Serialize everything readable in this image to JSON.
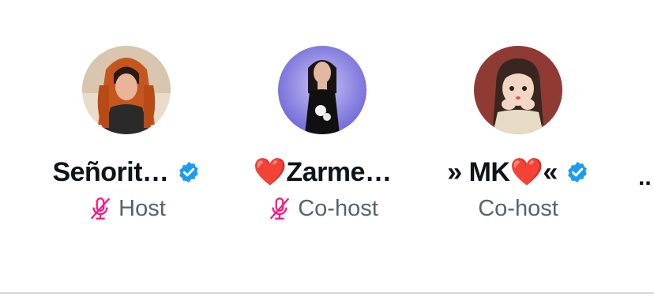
{
  "speakers": [
    {
      "name": "Señorit…",
      "verified": true,
      "role": "Host",
      "mic_muted": true,
      "avatar": "woman-red-hair-avatar"
    },
    {
      "name_heart": "❤️",
      "name": "Zarme…",
      "verified": false,
      "role": "Co-host",
      "mic_muted": true,
      "avatar": "woman-black-dress-avatar"
    },
    {
      "name_prefix": "» MK",
      "name_heart": "❤️",
      "name_suffix": "«",
      "verified": true,
      "role": "Co-host",
      "mic_muted": false,
      "avatar": "cartoon-girl-avatar"
    }
  ],
  "overflow": "..",
  "colors": {
    "verified_badge": "#1d9bf0",
    "mic_muted": "#f91880",
    "role_text": "#536471",
    "name_text": "#0f1419"
  }
}
